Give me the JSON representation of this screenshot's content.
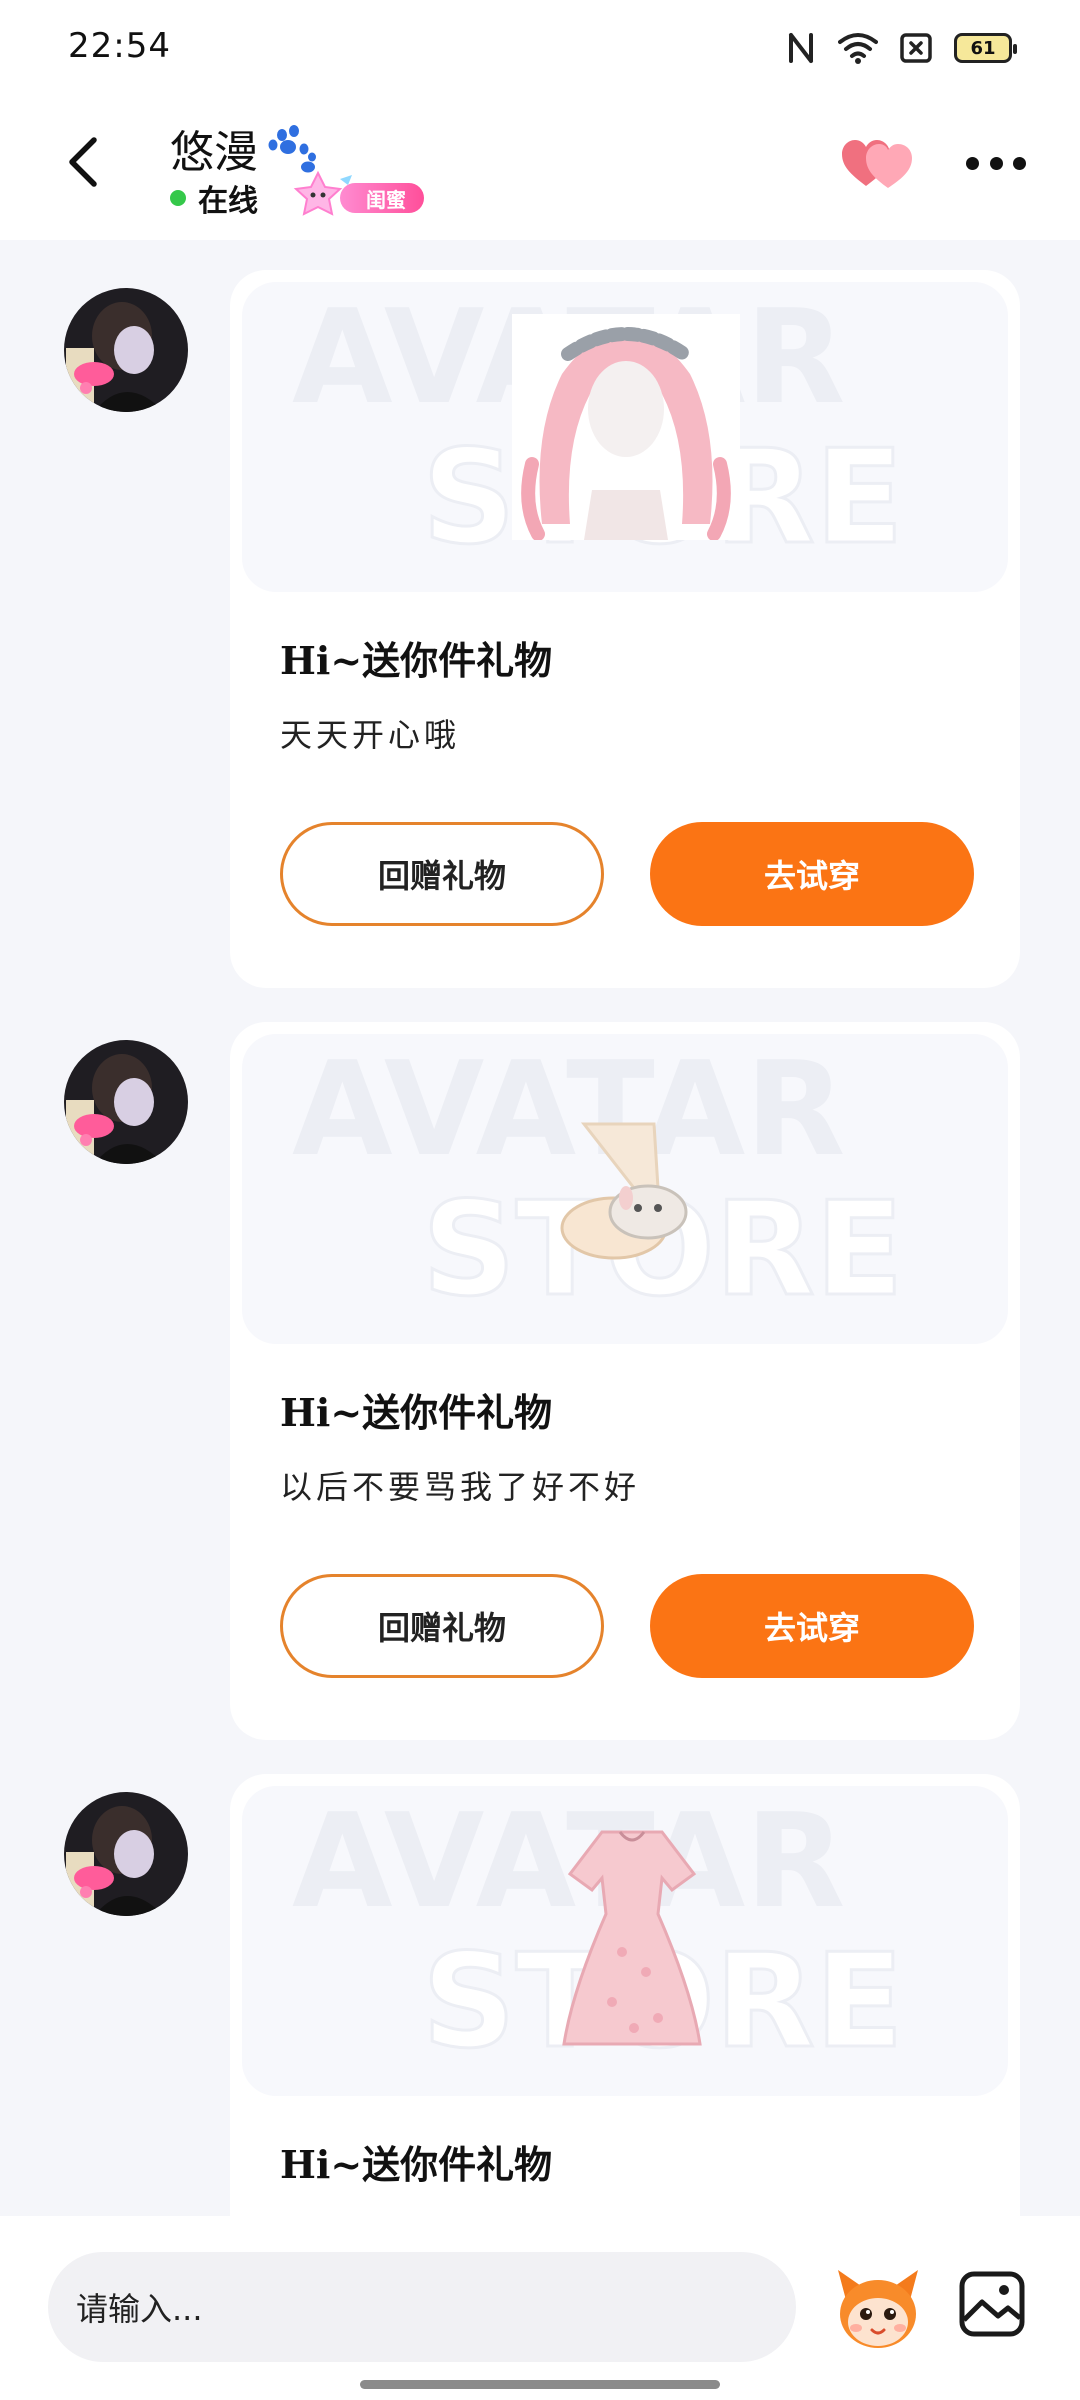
{
  "status_bar": {
    "time": "22:54",
    "battery": "61",
    "icons": [
      "nfc-icon",
      "wifi-icon",
      "sim-off-icon",
      "battery-icon"
    ]
  },
  "header": {
    "contact_name": "悠漫",
    "online_status": "在线",
    "relation_tag": "闺蜜",
    "icons": [
      "back-arrow-icon",
      "paw-icon",
      "star-icon",
      "hearts-icon",
      "more-dots-icon"
    ]
  },
  "messages": [
    {
      "item": "hair",
      "title": "Hi~送你件礼物",
      "message": "天天开心哦",
      "return_label": "回赠礼物",
      "try_label": "去试穿"
    },
    {
      "item": "socks",
      "title": "Hi~送你件礼物",
      "message": "以后不要骂我了好不好",
      "return_label": "回赠礼物",
      "try_label": "去试穿"
    },
    {
      "item": "dress",
      "title": "Hi~送你件礼物"
    }
  ],
  "watermark": {
    "line1": "AVATAR",
    "line2": "STORE"
  },
  "input": {
    "placeholder": "请输入..."
  },
  "colors": {
    "accent": "#fb7414",
    "accent_border": "#e5832c",
    "online": "#35c84a",
    "tag": "#ff4f9a",
    "background": "#f5f6fa"
  }
}
